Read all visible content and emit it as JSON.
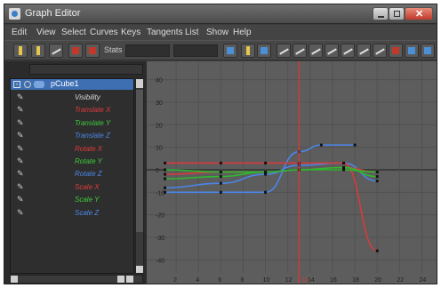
{
  "window": {
    "title": "Graph Editor"
  },
  "menu": [
    "Edit",
    "View",
    "Select",
    "Curves",
    "Keys",
    "Tangents",
    "List",
    "Show",
    "Help"
  ],
  "toolbar": {
    "stats_label": "Stats"
  },
  "outliner": {
    "node": "pCube1",
    "attributes": [
      {
        "label": "Visibility",
        "color": "#d8d8d8"
      },
      {
        "label": "Translate X",
        "color": "#e03a3a"
      },
      {
        "label": "Translate Y",
        "color": "#3ccc3c"
      },
      {
        "label": "Translate Z",
        "color": "#4a86e8"
      },
      {
        "label": "Rotate X",
        "color": "#e03a3a"
      },
      {
        "label": "Rotate Y",
        "color": "#3ccc3c"
      },
      {
        "label": "Rotate Z",
        "color": "#4a86e8"
      },
      {
        "label": "Scale X",
        "color": "#e03a3a"
      },
      {
        "label": "Scale Y",
        "color": "#3ccc3c"
      },
      {
        "label": "Scale Z",
        "color": "#4a86e8"
      }
    ]
  },
  "graph": {
    "y_ticks": [
      "40",
      "30",
      "20",
      "10",
      "0",
      "-10",
      "-20",
      "-30",
      "-40"
    ],
    "x_ticks": [
      "2",
      "4",
      "6",
      "8",
      "10",
      "12",
      "14",
      "16",
      "18",
      "20",
      "22",
      "24"
    ],
    "current_frame": "13",
    "time_indicator_color": "#d23a3a",
    "curve_colors": {
      "x": "#d83a3a",
      "y": "#2fb82f",
      "z": "#4a86e8"
    }
  },
  "chart_data": {
    "type": "line",
    "title": "",
    "xlabel": "",
    "ylabel": "",
    "xlim": [
      0,
      25
    ],
    "ylim": [
      -45,
      45
    ],
    "series": [
      {
        "color": "#4a86e8",
        "x": [
          1,
          6,
          10,
          13,
          15,
          18
        ],
        "y": [
          -10,
          -10,
          -10,
          8,
          11,
          11
        ]
      },
      {
        "color": "#4a86e8",
        "x": [
          1,
          6,
          10,
          13,
          17,
          20
        ],
        "y": [
          -8,
          -6,
          -2,
          2,
          3,
          -5
        ]
      },
      {
        "color": "#d83a3a",
        "x": [
          1,
          6,
          10,
          13,
          17,
          20
        ],
        "y": [
          3,
          3,
          3,
          3,
          3,
          -36
        ]
      },
      {
        "color": "#d83a3a",
        "x": [
          1,
          6,
          10,
          13,
          17,
          20
        ],
        "y": [
          -2,
          -1,
          -1,
          0,
          1,
          -1
        ]
      },
      {
        "color": "#2fb82f",
        "x": [
          1,
          6,
          10,
          13,
          17,
          20
        ],
        "y": [
          0,
          -1,
          -1,
          0,
          0,
          -1
        ]
      },
      {
        "color": "#2fb82f",
        "x": [
          1,
          6,
          10,
          13,
          17,
          20
        ],
        "y": [
          -4,
          -3,
          -1,
          0,
          1,
          -3
        ]
      }
    ]
  }
}
